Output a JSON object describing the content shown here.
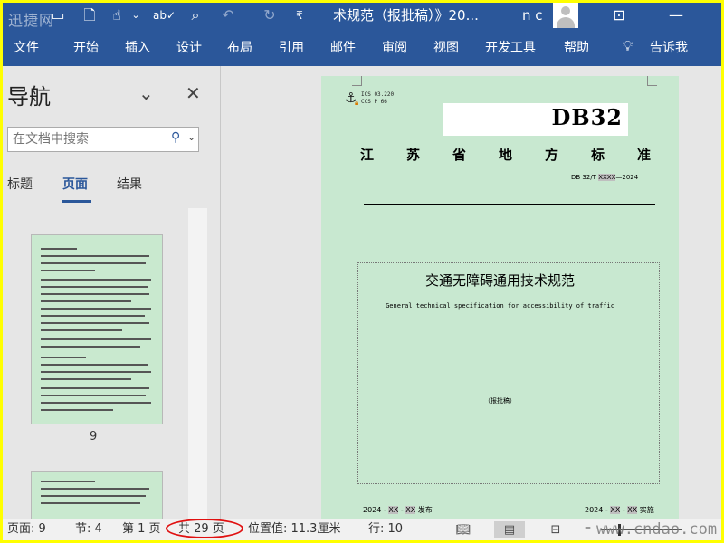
{
  "titlebar": {
    "title": "术规范（报批稿）》20...",
    "user": "n c",
    "icons": [
      "save-icon",
      "new-doc-icon",
      "touch-mode-icon",
      "chevron-down-icon",
      "spell-check-icon",
      "print-preview-icon",
      "undo-icon",
      "redo-icon",
      "customize-qat-icon",
      "ribbon-display-icon",
      "minimize-icon"
    ],
    "watermark": "迅捷网"
  },
  "ribbon": {
    "tabs": [
      "文件",
      "开始",
      "插入",
      "设计",
      "布局",
      "引用",
      "邮件",
      "审阅",
      "视图",
      "开发工具",
      "帮助"
    ],
    "tell_me": "告诉我"
  },
  "nav_pane": {
    "title": "导航",
    "search_placeholder": "在文档中搜索",
    "tabs": [
      "标题",
      "页面",
      "结果"
    ],
    "active_tab": "页面",
    "thumb_page_label": "9"
  },
  "document": {
    "ics_line1": "ICS  03.220",
    "ics_line2": "CCS  P 66",
    "db_label": "DB32",
    "province_chars": [
      "江",
      "苏",
      "省",
      "地",
      "方",
      "标",
      "准"
    ],
    "std_prefix": "DB 32/T ",
    "std_xxxx": "XXXX",
    "std_suffix": "—2024",
    "main_title": "交通无障碍通用技术规范",
    "english_title": "General technical specification for accessibility of traffic",
    "draft_label": "（报批稿）",
    "issue_year": "2024 - ",
    "issue_xx1": "XX",
    "issue_sep": " - ",
    "issue_xx2": "XX",
    "issue_suffix": " 发布",
    "impl_year": "2024 - ",
    "impl_xx1": "XX",
    "impl_sep": " - ",
    "impl_xx2": "XX",
    "impl_suffix": " 实施"
  },
  "statusbar": {
    "page": "页面: 9",
    "section": "节: 4",
    "page_of": "第 1 页",
    "total_pages": "共 29 页",
    "position": "位置值: 11.3厘米",
    "line": "行: 10",
    "watermark": "www.cndao.com",
    "zoom_minus": "–"
  },
  "colors": {
    "ribbon": "#2b579a",
    "page_bg": "#c8e8d0",
    "highlight_circle": "#e01010"
  }
}
